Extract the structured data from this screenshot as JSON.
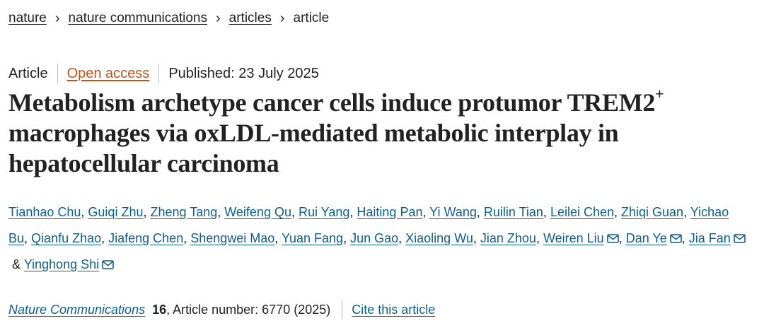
{
  "breadcrumb": {
    "items": [
      {
        "label": "nature",
        "link": true
      },
      {
        "label": "nature communications",
        "link": true
      },
      {
        "label": "articles",
        "link": true
      },
      {
        "label": "article",
        "link": false
      }
    ],
    "separator": "›"
  },
  "meta": {
    "type": "Article",
    "access": "Open access",
    "published": "Published: 23 July 2025"
  },
  "title": {
    "main": "Metabolism archetype cancer cells induce protumor TREM2",
    "superscript": "+",
    "rest": " macrophages via oxLDL-mediated metabolic interplay in hepatocellular carcinoma"
  },
  "authors": [
    {
      "name": "Tianhao Chu",
      "mail": false,
      "sep": ", "
    },
    {
      "name": "Guiqi Zhu",
      "mail": false,
      "sep": ", "
    },
    {
      "name": "Zheng Tang",
      "mail": false,
      "sep": ", "
    },
    {
      "name": "Weifeng Qu",
      "mail": false,
      "sep": ", "
    },
    {
      "name": "Rui Yang",
      "mail": false,
      "sep": ", "
    },
    {
      "name": "Haiting Pan",
      "mail": false,
      "sep": ", "
    },
    {
      "name": "Yi Wang",
      "mail": false,
      "sep": ", "
    },
    {
      "name": "Ruilin Tian",
      "mail": false,
      "sep": ", "
    },
    {
      "name": "Leilei Chen",
      "mail": false,
      "sep": ", "
    },
    {
      "name": "Zhiqi Guan",
      "mail": false,
      "sep": ", "
    },
    {
      "name": "Yichao Bu",
      "mail": false,
      "sep": ", "
    },
    {
      "name": "Qianfu Zhao",
      "mail": false,
      "sep": ", "
    },
    {
      "name": "Jiafeng Chen",
      "mail": false,
      "sep": ", "
    },
    {
      "name": "Shengwei Mao",
      "mail": false,
      "sep": ", "
    },
    {
      "name": "Yuan Fang",
      "mail": false,
      "sep": ", "
    },
    {
      "name": "Jun Gao",
      "mail": false,
      "sep": ", "
    },
    {
      "name": "Xiaoling Wu",
      "mail": false,
      "sep": ", "
    },
    {
      "name": "Jian Zhou",
      "mail": false,
      "sep": ", "
    },
    {
      "name": "Weiren Liu",
      "mail": true,
      "sep": ", "
    },
    {
      "name": "Dan Ye",
      "mail": true,
      "sep": ", "
    },
    {
      "name": "Jia Fan",
      "mail": true,
      "sep": " & "
    },
    {
      "name": "Yinghong Shi",
      "mail": true,
      "sep": ""
    }
  ],
  "citation": {
    "journal": "Nature Communications",
    "volume": "16",
    "details": ", Article number: 6770 (2025)",
    "cite_label": "Cite this article"
  },
  "colors": {
    "link": "#0d5f8f",
    "open_access": "#c4541c",
    "text": "#222222"
  },
  "icons": {
    "mail": "envelope-icon",
    "separator": "chevron-right-icon"
  }
}
